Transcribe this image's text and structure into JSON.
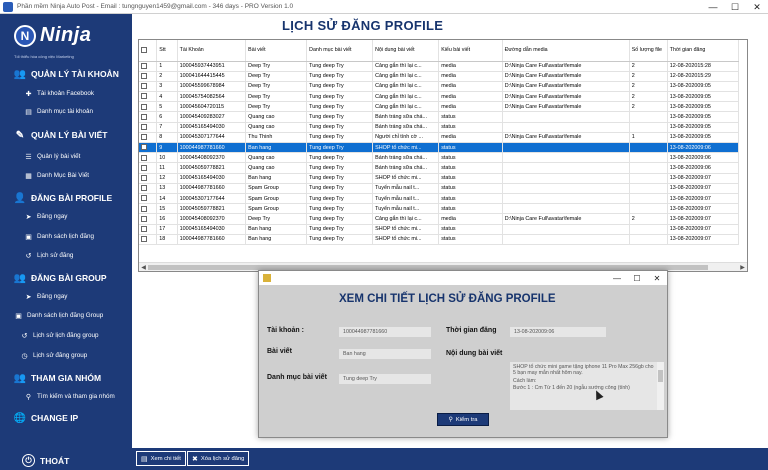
{
  "window": {
    "title": "Phần mềm Ninja Auto Post - Email : tungnguyen1459@gmail.com - 346 days - PRO Version 1.0",
    "minimize": "—",
    "maximize": "☐",
    "close": "✕"
  },
  "logo": {
    "mark": "N",
    "text": "Ninja",
    "tagline": "Tối thiểu hóa công việc Marketing"
  },
  "sidebar": {
    "sections": [
      {
        "label": "QUẢN LÝ TÀI KHOẢN",
        "icon": "users-icon",
        "items": [
          {
            "label": "Tài khoản Facebook",
            "icon": "add-user-icon"
          },
          {
            "label": "Danh mục tài khoản",
            "icon": "list-icon"
          }
        ]
      },
      {
        "label": "QUẢN LÝ BÀI VIẾT",
        "icon": "post-icon",
        "items": [
          {
            "label": "Quản lý bài viết",
            "icon": "list-icon"
          },
          {
            "label": "Danh Mục Bài Viết",
            "icon": "folder-icon"
          }
        ]
      },
      {
        "label": "ĐĂNG BÀI PROFILE",
        "icon": "profile-icon",
        "items": [
          {
            "label": "Đăng ngay",
            "icon": "send-icon"
          },
          {
            "label": "Danh sách lịch đăng",
            "icon": "calendar-icon"
          },
          {
            "label": "Lịch sử đăng",
            "icon": "history-icon"
          }
        ]
      },
      {
        "label": "ĐĂNG BÀI GROUP",
        "icon": "group-icon",
        "items": [
          {
            "label": "Đăng ngay",
            "icon": "send-icon"
          },
          {
            "label": "Danh sách lịch đăng Group",
            "icon": "calendar-icon"
          },
          {
            "label": "Lịch sử lịch đăng group",
            "icon": "history-icon"
          },
          {
            "label": "Lịch sử đăng group",
            "icon": "clock-icon"
          }
        ]
      },
      {
        "label": "THAM GIA NHÓM",
        "icon": "join-group-icon",
        "items": [
          {
            "label": "Tìm kiếm và tham gia nhóm",
            "icon": "search-icon"
          }
        ]
      },
      {
        "label": "CHANGE IP",
        "icon": "globe-icon",
        "items": []
      }
    ],
    "logout": "THOÁT"
  },
  "page": {
    "title": "LỊCH SỬ ĐĂNG PROFILE"
  },
  "grid": {
    "columns": [
      "",
      "Stt",
      "Tài Khoản",
      "Bài viết",
      "Danh mục bài viết",
      "Nội dung bài viết",
      "Kiểu bài viết",
      "Đường dẫn media",
      "Số lượng file",
      "Thời gian đăng"
    ],
    "rows": [
      [
        "1",
        "100045937443951",
        "Deep Try",
        "Tung deep Try",
        "Cảng gắn thì lại c...",
        "media",
        "D:\\Ninja Care Full\\avatar\\female",
        "2",
        "12-08-202015:28"
      ],
      [
        "2",
        "100041644415445",
        "Deep Try",
        "Tung deep Try",
        "Cảng gắn thì lại c...",
        "media",
        "D:\\Ninja Care Full\\avatar\\female",
        "2",
        "12-08-202015:29"
      ],
      [
        "3",
        "100045599678984",
        "Deep Try",
        "Tung deep Try",
        "Cảng gắn thì lại c...",
        "media",
        "D:\\Ninja Care Full\\avatar\\female",
        "2",
        "13-08-202009:05"
      ],
      [
        "4",
        "100045754082564",
        "Deep Try",
        "Tung deep Try",
        "Cảng gắn thì lại c...",
        "media",
        "D:\\Ninja Care Full\\avatar\\female",
        "2",
        "13-08-202009:05"
      ],
      [
        "5",
        "100045604720115",
        "Deep Try",
        "Tung deep Try",
        "Cảng gắn thì lại c...",
        "media",
        "D:\\Ninja Care Full\\avatar\\female",
        "2",
        "13-08-202009:05"
      ],
      [
        "6",
        "100045409283027",
        "Quang cao",
        "Tung deep Try",
        "Bánh tráng sữa chá...",
        "status",
        "",
        "",
        "13-08-202009:05"
      ],
      [
        "7",
        "100045165494030",
        "Quang cao",
        "Tung deep Try",
        "Bánh tráng sữa chá...",
        "status",
        "",
        "",
        "13-08-202009:05"
      ],
      [
        "8",
        "100045307177644",
        "Thu Thinh",
        "Tung deep Try",
        "Người chỉ tính cờ ...",
        "media",
        "D:\\Ninja Care Full\\avatar\\female",
        "1",
        "13-08-202009:05"
      ],
      [
        "9",
        "100044987781660",
        "Ban hang",
        "Tung deep Try",
        "SHOP tổ chức mi...",
        "status",
        "",
        "",
        "13-08-202009:06"
      ],
      [
        "10",
        "100045408092370",
        "Quang cao",
        "Tung deep Try",
        "Bánh tráng sữa chá...",
        "status",
        "",
        "",
        "13-08-202009:06"
      ],
      [
        "11",
        "100045059778821",
        "Quang cao",
        "Tung deep Try",
        "Bánh tráng sữa chá...",
        "status",
        "",
        "",
        "13-08-202009:06"
      ],
      [
        "12",
        "100045165494030",
        "Ban hang",
        "Tung deep Try",
        "SHOP tổ chức mi...",
        "status",
        "",
        "",
        "13-08-202009:07"
      ],
      [
        "13",
        "100044987781660",
        "Spam Group",
        "Tung deep Try",
        "Tuyển mẫu nail t...",
        "status",
        "",
        "",
        "13-08-202009:07"
      ],
      [
        "14",
        "100045307177644",
        "Spam Group",
        "Tung deep Try",
        "Tuyển mẫu nail t...",
        "status",
        "",
        "",
        "13-08-202009:07"
      ],
      [
        "15",
        "100045059778821",
        "Spam Group",
        "Tung deep Try",
        "Tuyển mẫu nail t...",
        "status",
        "",
        "",
        "13-08-202009:07"
      ],
      [
        "16",
        "100045408092370",
        "Deep Try",
        "Tung deep Try",
        "Cảng gắn thì lại c...",
        "media",
        "D:\\Ninja Care Full\\avatar\\female",
        "2",
        "13-08-202009:07"
      ],
      [
        "17",
        "100045165494030",
        "Ban hang",
        "Tung deep Try",
        "SHOP tổ chức mi...",
        "status",
        "",
        "",
        "13-08-202009:07"
      ],
      [
        "18",
        "100044987781660",
        "Ban hang",
        "Tung deep Try",
        "SHOP tổ chức mi...",
        "status",
        "",
        "",
        "13-08-202009:07"
      ]
    ],
    "selected_row": 8
  },
  "dialog": {
    "title": "",
    "heading": "XEM CHI TIẾT LỊCH SỬ ĐĂNG PROFILE",
    "labels": {
      "account": "Tài khoản :",
      "post": "Bài viết",
      "category": "Danh mục bài viết",
      "time": "Thời gian đăng",
      "content": "Nội dung bài viết"
    },
    "values": {
      "account": "100044987781660",
      "post": "Ban hang",
      "category": "Tung deep Try",
      "time": "13-08-202009:06",
      "content": [
        "SHOP tổ chức mini game tặng iphone 11 Pro Max 256gb cho 5 bạn may mắn nhất hôm nay.",
        "Cách làm:",
        "Bước 1 : Cm Từ 1 đến 20 (ngẫu sướng công (tính)"
      ]
    },
    "check_button": "Kiểm tra"
  },
  "footer": {
    "view_detail": "Xem chi tiết",
    "delete_history": "Xóa lịch sử đăng"
  }
}
